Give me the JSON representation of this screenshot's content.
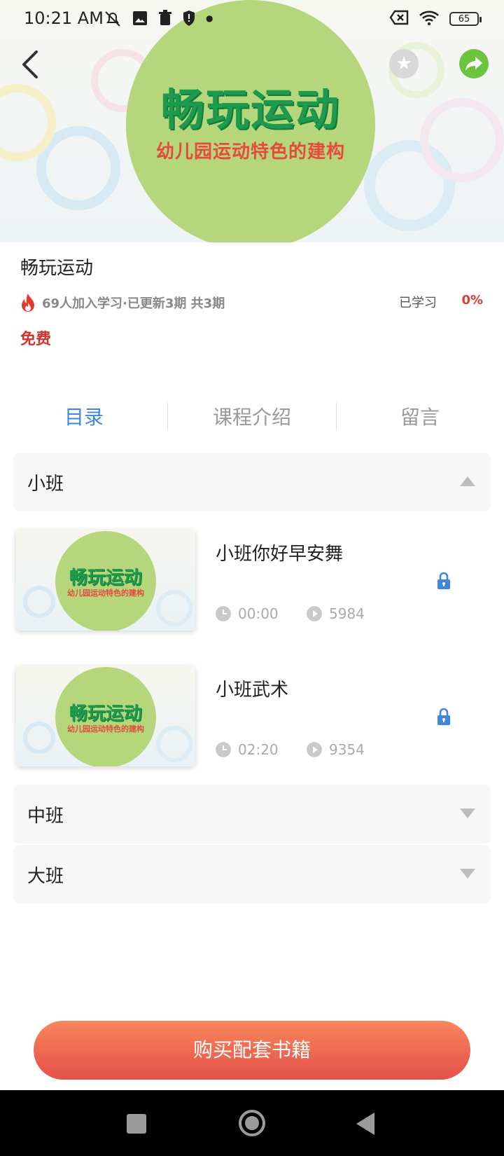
{
  "status_bar": {
    "time": "10:21 AM",
    "battery": "65"
  },
  "banner": {
    "title": "畅玩运动",
    "subtitle": "幼儿园运动特色的建构"
  },
  "course": {
    "title": "畅玩运动",
    "stats": "69人加入学习·已更新3期 共3期",
    "progress_label": "已学习",
    "progress_value": "0%",
    "price": "免费"
  },
  "tabs": [
    {
      "label": "目录",
      "active": true
    },
    {
      "label": "课程介绍",
      "active": false
    },
    {
      "label": "留言",
      "active": false
    }
  ],
  "sections": [
    {
      "name": "小班",
      "expanded": true,
      "lessons": [
        {
          "title": "小班你好早安舞",
          "duration": "00:00",
          "plays": "5984",
          "locked": true,
          "thumb_title": "畅玩运动",
          "thumb_sub": "幼儿园运动特色的建构"
        },
        {
          "title": "小班武术",
          "duration": "02:20",
          "plays": "9354",
          "locked": true,
          "thumb_title": "畅玩运动",
          "thumb_sub": "幼儿园运动特色的建构"
        }
      ]
    },
    {
      "name": "中班",
      "expanded": false
    },
    {
      "name": "大班",
      "expanded": false
    }
  ],
  "buy_button": "购买配套书籍",
  "colors": {
    "accent": "#3f86df",
    "price": "#d2322b",
    "button_start": "#f8875c",
    "button_end": "#e4504a"
  },
  "icons": [
    "back-arrow-icon",
    "star-icon",
    "share-icon",
    "fire-icon",
    "lock-icon",
    "clock-icon",
    "play-icon"
  ]
}
